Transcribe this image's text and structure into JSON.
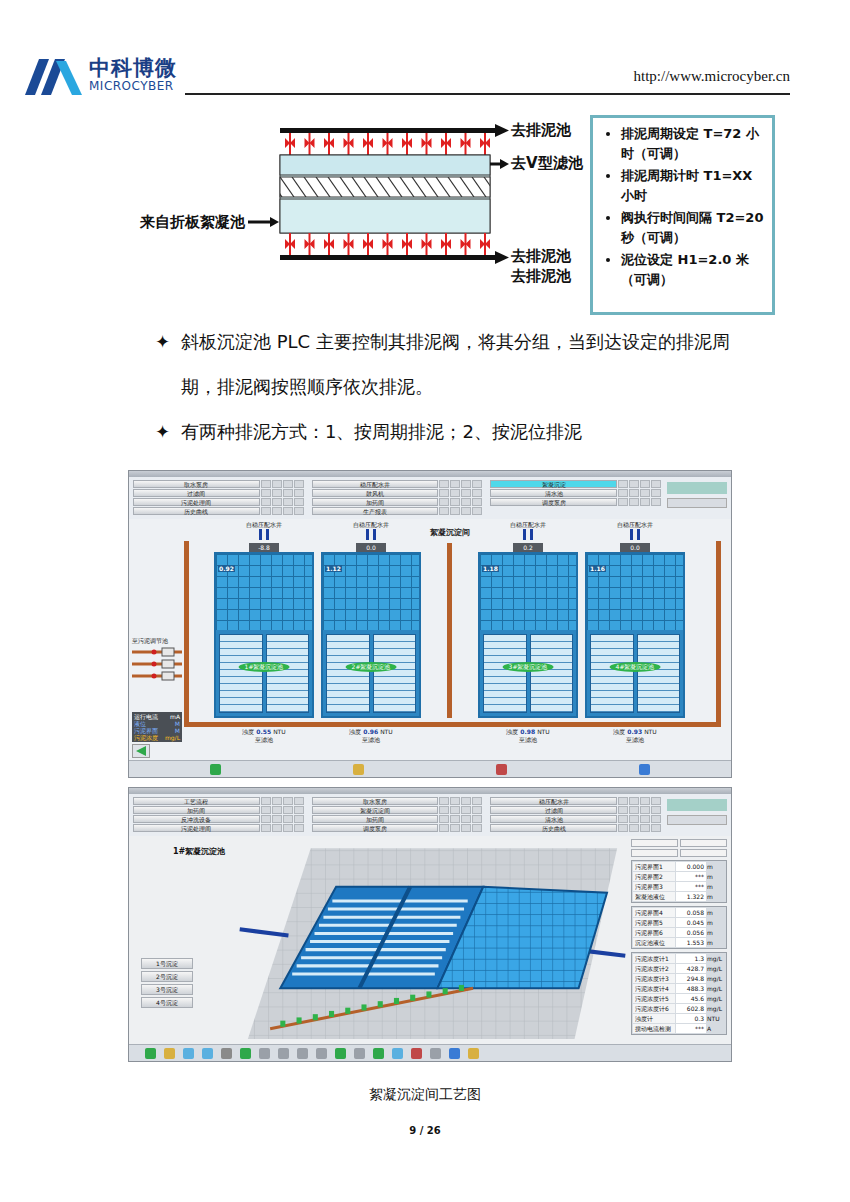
{
  "header": {
    "logo_cn": "中科博微",
    "logo_en": "MICROCYBER",
    "url": "http://www.microcyber.cn"
  },
  "schematic": {
    "top_outlet": "去排泥池",
    "filter_outlet": "去V型滤池",
    "inlet": "来自折板絮凝池",
    "bottom_outlets": [
      "去排泥池",
      "去排泥池"
    ]
  },
  "settings": [
    "排泥周期设定 T=72 小时（可调）",
    "排泥周期计时 T1=XX 小时",
    "阀执行时间间隔 T2=20 秒（可调）",
    "泥位设定 H1=2.0 米（可调）"
  ],
  "bullets": [
    {
      "mark": "✦",
      "text": "斜板沉淀池 PLC 主要控制其排泥阀，将其分组，当到达设定的排泥周期，排泥阀按照顺序依次排泥。"
    },
    {
      "mark": "✦",
      "text": "有两种排泥方式：1、按周期排泥；2、按泥位排泥"
    }
  ],
  "scada1": {
    "nav": [
      {
        "label": "取水泵房",
        "selected": false
      },
      {
        "label": "稳压配水井",
        "selected": false
      },
      {
        "label": "絮凝沉淀",
        "selected": true
      },
      {
        "label": "过滤间",
        "selected": false
      },
      {
        "label": "鼓风机",
        "selected": false
      },
      {
        "label": "清水池",
        "selected": false
      },
      {
        "label": "污泥处理间",
        "selected": false
      },
      {
        "label": "加药间",
        "selected": false
      },
      {
        "label": "调度泵房",
        "selected": false
      },
      {
        "label": "历史曲线",
        "selected": false
      },
      {
        "label": "生产报表",
        "selected": false
      }
    ],
    "title": "絮凝沉淀间",
    "tanks": [
      {
        "inlet": "自稳压配水井",
        "reading": "-8.8",
        "level": "0.92",
        "name": "1#絮凝沉淀池",
        "turbidity_label": "浊度",
        "turbidity": "0.55",
        "unit": "NTU",
        "outlet": "至滤池"
      },
      {
        "inlet": "自稳压配水井",
        "reading": "0.0",
        "level": "1.12",
        "name": "2#絮凝沉淀池",
        "turbidity_label": "浊度",
        "turbidity": "0.96",
        "unit": "NTU",
        "outlet": "至滤池"
      },
      {
        "inlet": "自稳压配水井",
        "reading": "0.2",
        "level": "1.18",
        "name": "3#絮凝沉淀池",
        "turbidity_label": "浊度",
        "turbidity": "0.98",
        "unit": "NTU",
        "outlet": "至滤池"
      },
      {
        "inlet": "自稳压配水井",
        "reading": "0.0",
        "level": "1.16",
        "name": "4#絮凝沉淀池",
        "turbidity_label": "浊度",
        "turbidity": "0.93",
        "unit": "NTU",
        "outlet": "至滤池"
      }
    ],
    "sludge_outlet": "至污泥调节池",
    "legend": [
      {
        "label": "运行电流",
        "unit": "mA",
        "color": "#ffffff"
      },
      {
        "label": "液位",
        "unit": "M",
        "color": "#7fb2ff"
      },
      {
        "label": "污泥界面",
        "unit": "M",
        "color": "#7fb2ff"
      },
      {
        "label": "污泥浓度",
        "unit": "mg/L",
        "color": "#ffc020"
      }
    ]
  },
  "scada2": {
    "nav": [
      {
        "label": "工艺流程",
        "selected": false
      },
      {
        "label": "取水泵房",
        "selected": false
      },
      {
        "label": "稳压配水井",
        "selected": false
      },
      {
        "label": "加药间",
        "selected": false
      },
      {
        "label": "絮凝沉淀间",
        "selected": false
      },
      {
        "label": "过滤间",
        "selected": false
      },
      {
        "label": "反冲洗设备",
        "selected": false
      },
      {
        "label": "加药间",
        "selected": false
      },
      {
        "label": "清水池",
        "selected": false
      },
      {
        "label": "污泥处理间",
        "selected": false
      },
      {
        "label": "调度泵房",
        "selected": false
      },
      {
        "label": "历史曲线",
        "selected": false
      }
    ],
    "title": "1#絮凝沉淀池",
    "tank_buttons": [
      "1号沉淀",
      "2号沉淀",
      "3号沉淀",
      "4号沉淀"
    ],
    "panels": [
      {
        "rows": [
          {
            "label": "污泥界面1",
            "value": "0.000",
            "unit": "m"
          },
          {
            "label": "污泥界面2",
            "value": "***",
            "unit": "m"
          },
          {
            "label": "污泥界面3",
            "value": "***",
            "unit": "m"
          },
          {
            "label": "絮凝池液位",
            "value": "1.322",
            "unit": "m"
          }
        ]
      },
      {
        "rows": [
          {
            "label": "污泥界面4",
            "value": "0.058",
            "unit": "m"
          },
          {
            "label": "污泥界面5",
            "value": "0.045",
            "unit": "m"
          },
          {
            "label": "污泥界面6",
            "value": "0.056",
            "unit": "m"
          },
          {
            "label": "沉淀池液位",
            "value": "1.553",
            "unit": "m"
          }
        ]
      },
      {
        "rows": [
          {
            "label": "污泥浓度计1",
            "value": "1.3",
            "unit": "mg/L"
          },
          {
            "label": "污泥浓度计2",
            "value": "428.7",
            "unit": "mg/L"
          },
          {
            "label": "污泥浓度计3",
            "value": "294.8",
            "unit": "mg/L"
          },
          {
            "label": "污泥浓度计4",
            "value": "488.3",
            "unit": "mg/L"
          },
          {
            "label": "污泥浓度计5",
            "value": "45.6",
            "unit": "mg/L"
          },
          {
            "label": "污泥浓度计6",
            "value": "602.8",
            "unit": "mg/L"
          },
          {
            "label": "浊度计",
            "value": "0.3",
            "unit": "NTU"
          },
          {
            "label": "搅动电流检测",
            "value": "***",
            "unit": "A"
          }
        ]
      }
    ]
  },
  "caption": "絮凝沉淀间工艺图",
  "page_number": "9 / 26"
}
